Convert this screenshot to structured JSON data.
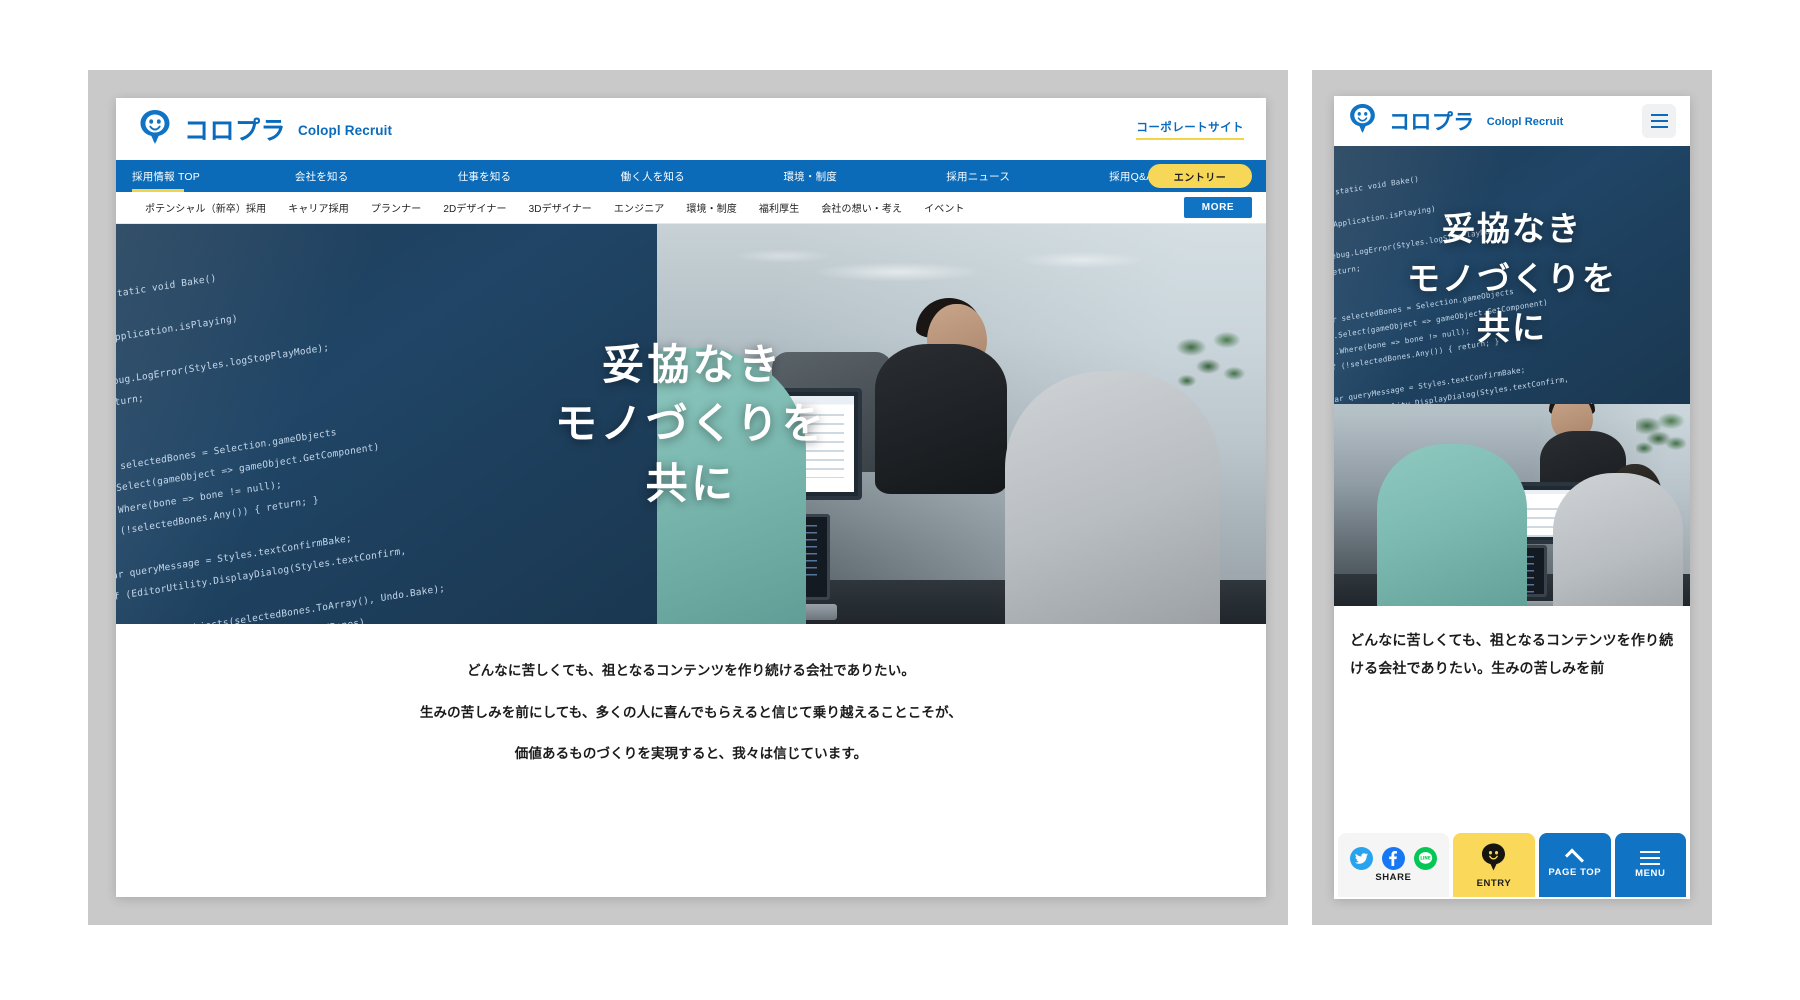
{
  "brand": {
    "logo_jp": "コロプラ",
    "logo_sub": "Colopl Recruit",
    "accent_blue": "#0b6bb8",
    "accent_yellow": "#f6d757"
  },
  "desktop": {
    "header": {
      "corporate_link": "コーポレートサイト"
    },
    "main_nav": {
      "items": [
        {
          "label": "採用情報 TOP",
          "active": true
        },
        {
          "label": "会社を知る",
          "active": false
        },
        {
          "label": "仕事を知る",
          "active": false
        },
        {
          "label": "働く人を知る",
          "active": false
        },
        {
          "label": "環境・制度",
          "active": false
        },
        {
          "label": "採用ニュース",
          "active": false
        },
        {
          "label": "採用Q&A",
          "active": false
        }
      ],
      "entry_button": "エントリー"
    },
    "sub_nav": {
      "items": [
        "ポテンシャル（新卒）採用",
        "キャリア採用",
        "プランナー",
        "2Dデザイナー",
        "3Dデザイナー",
        "エンジニア",
        "環境・制度",
        "福利厚生",
        "会社の想い・考え",
        "イベント"
      ],
      "more_button": "MORE"
    },
    "hero": {
      "line1": "妥協なき",
      "line2": "モノづくりを",
      "line3": "共に",
      "code_overlay": "public static void Bake()\n{\n  if (Application.isPlaying)\n  {\n    Debug.LogError(Styles.logStopPlayMode);\n    return;\n  }\n\n  var selectedBones = Selection.gameObjects\n    .Select(gameObject => gameObject.GetComponent)\n    .Where(bone => bone != null);\n  if (!selectedBones.Any()) { return; }\n\n  var queryMessage = Styles.textConfirmBake;\n  if (EditorUtility.DisplayDialog(Styles.textConfirm,\n  {\n    Undo.RecordObjects(selectedBones.ToArray(), Undo.Bake);\n    foreach (var springBone in selectedBones)\n    {\n      springBone.RemoveAllBones();"
    },
    "body": {
      "paragraphs": [
        "どんなに苦しくても、祖となるコンテンツを作り続ける会社でありたい。",
        "生みの苦しみを前にしても、多くの人に喜んでもらえると信じて乗り越えることこそが、",
        "価値あるものづくりを実現すると、我々は信じています。"
      ]
    }
  },
  "mobile": {
    "hero": {
      "line1": "妥協なき",
      "line2": "モノづくりを",
      "line3": "共に"
    },
    "body": {
      "text": "どんなに苦しくても、祖となるコンテンツを作り続ける会社でありたい。生みの苦しみを前"
    },
    "bottom_bar": {
      "share_label": "SHARE",
      "entry_label": "ENTRY",
      "page_top_label": "PAGE TOP",
      "menu_label": "MENU"
    }
  }
}
